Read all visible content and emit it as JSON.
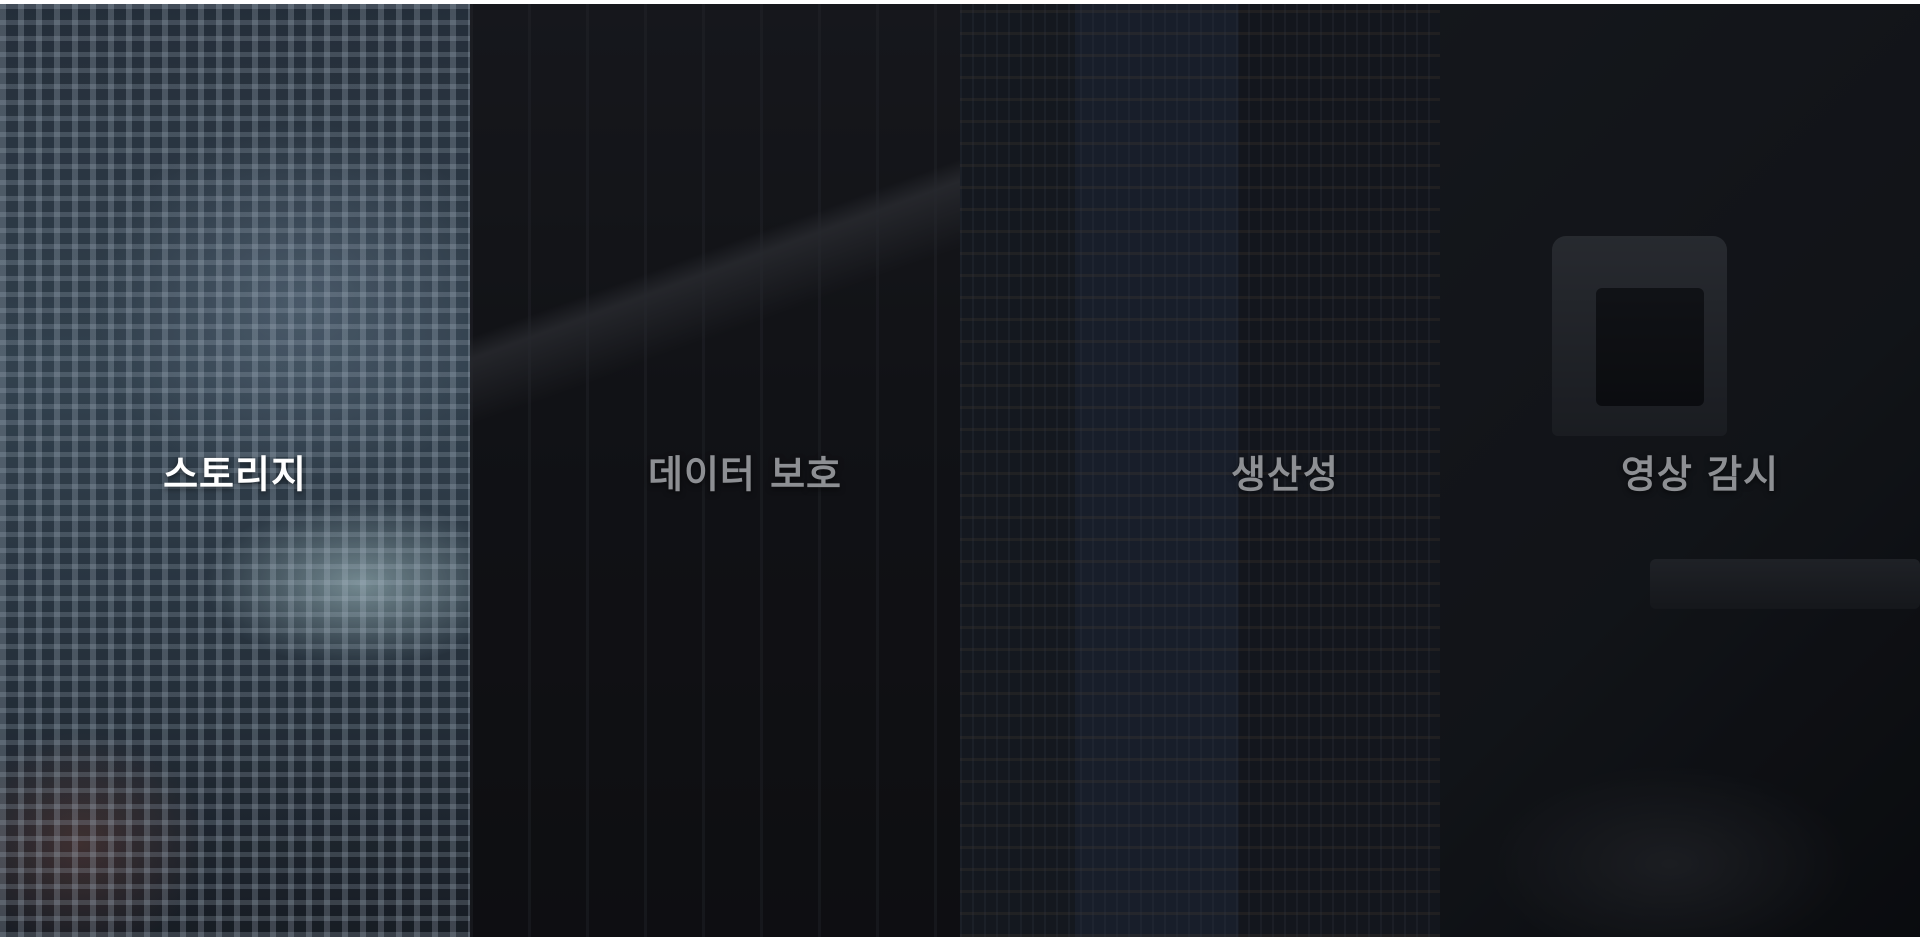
{
  "panels": [
    {
      "id": "storage",
      "label": "스토리지",
      "active": true
    },
    {
      "id": "data-protection",
      "label": "데이터 보호",
      "active": false
    },
    {
      "id": "productivity",
      "label": "생산성",
      "active": false
    },
    {
      "id": "video-surveillance",
      "label": "영상 감시",
      "active": false
    }
  ]
}
